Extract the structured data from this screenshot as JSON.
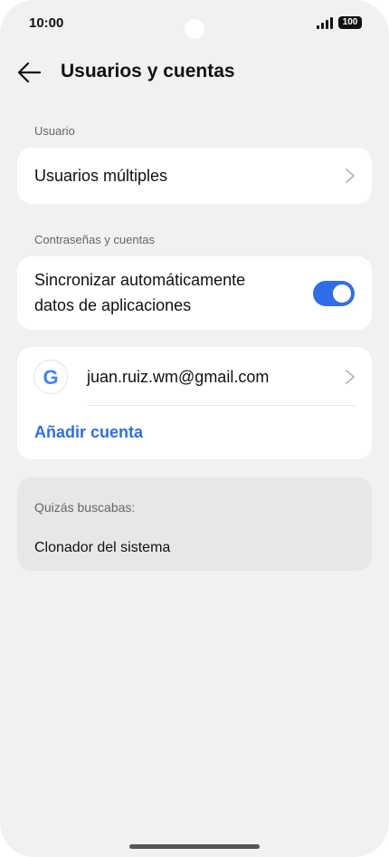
{
  "status_bar": {
    "time": "10:00",
    "battery": "100"
  },
  "header": {
    "title": "Usuarios y cuentas"
  },
  "sections": {
    "user": {
      "label": "Usuario",
      "item": "Usuarios múltiples"
    },
    "passwords": {
      "label": "Contraseñas y cuentas",
      "sync_line1": "Sincronizar automáticamente",
      "sync_line2": "datos de aplicaciones",
      "sync_enabled": true
    },
    "accounts": {
      "google_email": "juan.ruiz.wm@gmail.com",
      "add_account": "Añadir cuenta"
    }
  },
  "suggestions": {
    "label": "Quizás buscabas:",
    "items": [
      "Clonador del sistema"
    ]
  },
  "colors": {
    "accent": "#2f6ee6",
    "background": "#f0f1f3",
    "card": "#ffffff",
    "suggestion_card": "#e6e7e9"
  }
}
